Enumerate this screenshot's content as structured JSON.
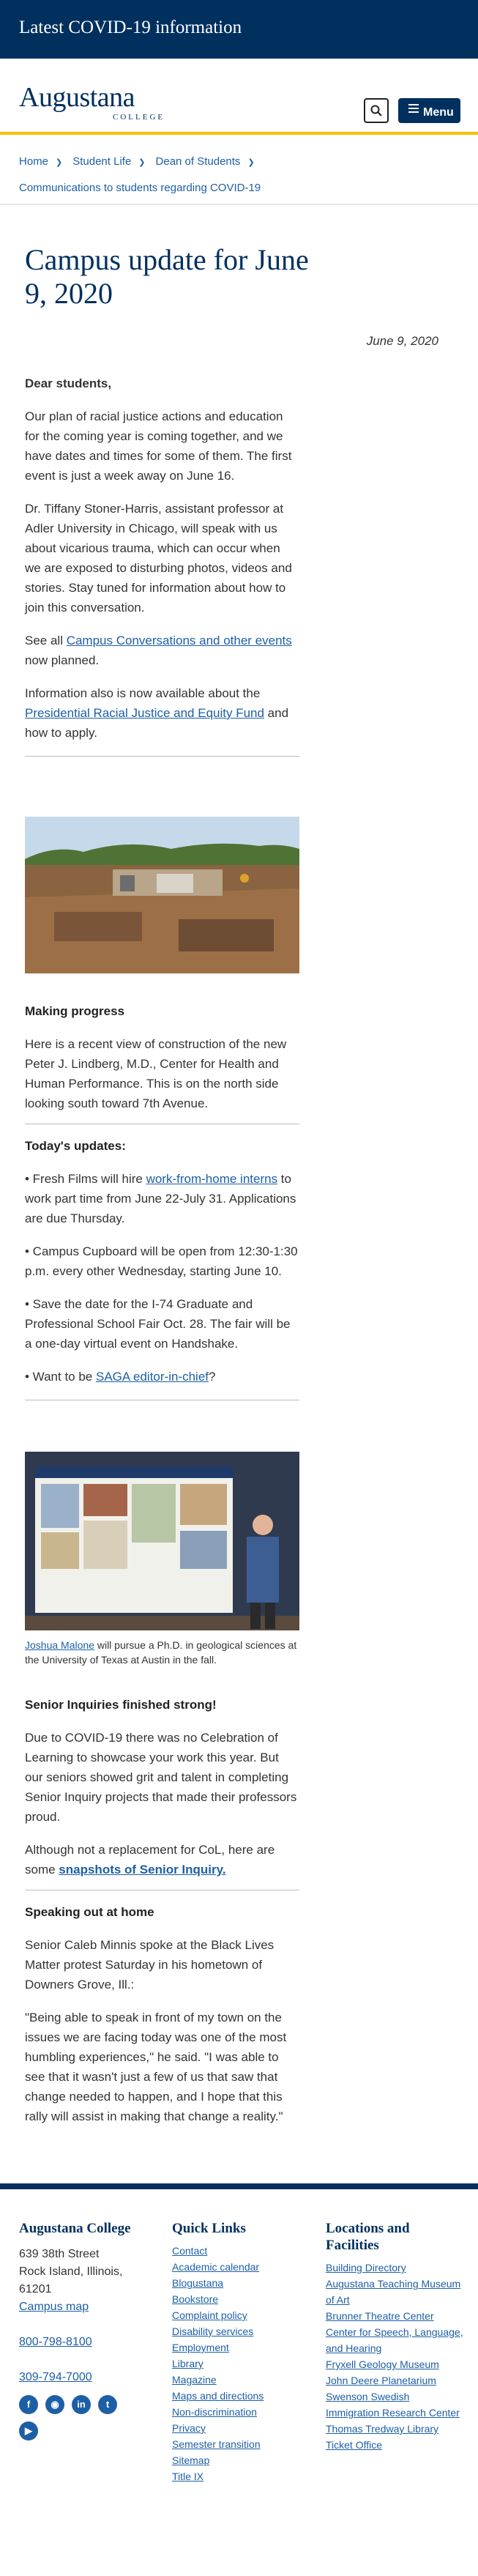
{
  "alert": {
    "text": "Latest COVID-19 information"
  },
  "header": {
    "logo_main": "Augustana",
    "logo_sub": "COLLEGE",
    "menu_label": "Menu"
  },
  "breadcrumb": {
    "items": [
      "Home",
      "Student Life",
      "Dean of Students"
    ],
    "current": "Communications to students regarding COVID-19"
  },
  "article": {
    "title": "Campus update for June 9, 2020",
    "date": "June 9, 2020",
    "greeting": "Dear students,",
    "p1": "Our plan of racial justice actions and education for the coming year is coming together, and we have dates and times for some of them. The first event is just a week away on June 16.",
    "p2": "Dr. Tiffany Stoner-Harris, assistant professor at Adler University in Chicago, will speak with us about vicarious trauma, which can occur when we are exposed to disturbing photos, videos and stories. Stay tuned for information about how to join this conversation.",
    "p3_pre": "See all ",
    "p3_link": "Campus Conversations and other events",
    "p3_post": " now planned.",
    "p4_pre": "Information also is now available about the ",
    "p4_link": "Presidential Racial Justice and Equity Fund",
    "p4_post": " and how to apply.",
    "progress_heading": "Making progress",
    "progress_text": "Here is a recent view of construction of the new Peter J. Lindberg, M.D., Center for Health and Human Performance. This is on the north side looking south toward 7th Avenue.",
    "updates_heading": "Today's updates:",
    "u1_pre": "• Fresh Films will hire ",
    "u1_link": "work-from-home interns",
    "u1_post": " to work part time from June 22-July 31. Applications are due Thursday.",
    "u2": "• Campus Cupboard will be open from 12:30-1:30 p.m. every other Wednesday, starting June 10.",
    "u3": "• Save the date for the I-74 Graduate and Professional School Fair Oct. 28. The fair will be a one-day virtual event on Handshake.",
    "u4_pre": "• Want to be ",
    "u4_link": "SAGA editor-in-chief",
    "u4_post": "?",
    "caption_link": "Joshua Malone",
    "caption_text": " will pursue a Ph.D. in geological sciences at the University of Texas at Austin in the fall.",
    "poster_title": "DETRITAL ZIRCON PROVENANCE OF QUARTZITE LITHOFACIES IN THE ALMAGOUR MORRISON FORMATION, WYOMING, USA",
    "senior_heading": "Senior Inquiries finished strong!",
    "senior_p1": "Due to COVID-19 there was no Celebration of Learning to showcase your work this year. But our seniors showed grit and talent in completing Senior Inquiry projects that made their professors proud.",
    "senior_p2_pre": "Although not a replacement for CoL, here are some ",
    "senior_p2_link": "snapshots of Senior Inquiry.",
    "speaking_heading": "Speaking out at home",
    "speaking_p1": "Senior Caleb Minnis spoke at the Black Lives Matter protest Saturday in his hometown of Downers Grove, Ill.:",
    "speaking_quote": "\"Being able to speak in front of my town on the issues we are facing today was one of the most humbling experiences,\" he said. \"I was able to see that it wasn't just a few of us that saw that change needed to happen, and I hope that this rally will assist in making that change a reality.\""
  },
  "footer": {
    "college_heading": "Augustana College",
    "address1": "639 38th Street",
    "address2": "Rock Island, Illinois,",
    "address3": "61201",
    "campus_map": "Campus map",
    "phone1": "800-798-8100",
    "phone2": "309-794-7000",
    "quick_heading": "Quick Links",
    "quick_links": [
      "Contact",
      "Academic calendar",
      "Blogustana",
      "Bookstore",
      "Complaint policy",
      "Disability services",
      "Employment",
      "Library",
      "Magazine",
      "Maps and directions",
      "Non-discrimination",
      "Privacy",
      "Semester transition",
      "Sitemap",
      "Title IX"
    ],
    "locations_heading": "Locations and Facilities",
    "locations": [
      "Building Directory",
      "Augustana Teaching Museum of Art",
      "Brunner Theatre Center",
      "Center for Speech, Language, and Hearing",
      "Fryxell Geology Museum",
      "John Deere Planetarium",
      "Swenson Swedish Immigration Research Center",
      "Thomas Tredway Library",
      "Ticket Office"
    ],
    "social": [
      "facebook-icon",
      "instagram-icon",
      "linkedin-icon",
      "twitter-icon",
      "youtube-icon"
    ]
  },
  "colors": {
    "navy": "#00305e",
    "gold": "#f2c200",
    "link": "#1d5fa6"
  }
}
